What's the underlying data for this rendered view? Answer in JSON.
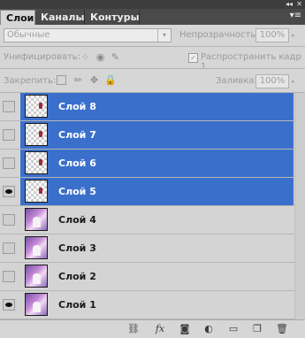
{
  "window": {
    "collapse_glyph": "◂◂",
    "close_glyph": "✕",
    "panel_menu_glyph": "▾≡"
  },
  "tabs": [
    {
      "label": "Слои",
      "active": true
    },
    {
      "label": "Каналы",
      "active": false
    },
    {
      "label": "Контуры",
      "active": false
    }
  ],
  "blend": {
    "value": "Обычные",
    "arrow_glyph": "▾"
  },
  "opacity": {
    "label": "Непрозрачность:",
    "value": "100%"
  },
  "unify": {
    "label": "Унифицировать:",
    "icons": [
      "unify-position-icon",
      "unify-visibility-icon",
      "unify-style-icon"
    ]
  },
  "propagate": {
    "label": "Распространить кадр 1",
    "checked": true,
    "check_glyph": "✓"
  },
  "lock": {
    "label": "Закрепить:",
    "icons": [
      "lock-transparency-icon",
      "lock-brush-icon",
      "lock-move-icon",
      "lock-all-icon"
    ]
  },
  "fill": {
    "label": "Заливка:",
    "value": "100%"
  },
  "layers": [
    {
      "name": "Слой 8",
      "visible": false,
      "selected": true,
      "thumb": "transparent"
    },
    {
      "name": "Слой 7",
      "visible": false,
      "selected": true,
      "thumb": "transparent"
    },
    {
      "name": "Слой 6",
      "visible": false,
      "selected": true,
      "thumb": "transparent"
    },
    {
      "name": "Слой 5",
      "visible": true,
      "selected": true,
      "thumb": "transparent"
    },
    {
      "name": "Слой 4",
      "visible": false,
      "selected": false,
      "thumb": "photo"
    },
    {
      "name": "Слой 3",
      "visible": false,
      "selected": false,
      "thumb": "photo"
    },
    {
      "name": "Слой 2",
      "visible": false,
      "selected": false,
      "thumb": "photo"
    },
    {
      "name": "Слой 1",
      "visible": true,
      "selected": false,
      "thumb": "photo"
    }
  ],
  "footer_buttons": [
    {
      "icon": "link-layers-icon",
      "glyph": "⛓"
    },
    {
      "icon": "layer-style-fx-icon",
      "glyph": "fx"
    },
    {
      "icon": "add-mask-icon",
      "glyph": "◙"
    },
    {
      "icon": "adjustment-layer-icon",
      "glyph": "◐"
    },
    {
      "icon": "new-group-folder-icon",
      "glyph": "▭"
    },
    {
      "icon": "new-layer-icon",
      "glyph": "❐"
    },
    {
      "icon": "delete-layer-trash-icon",
      "glyph": "🗑"
    }
  ],
  "colors": {
    "selection": "#3a6fcc",
    "panel_bg": "#d6d6d6",
    "tab_bar": "#4a4a4a"
  }
}
